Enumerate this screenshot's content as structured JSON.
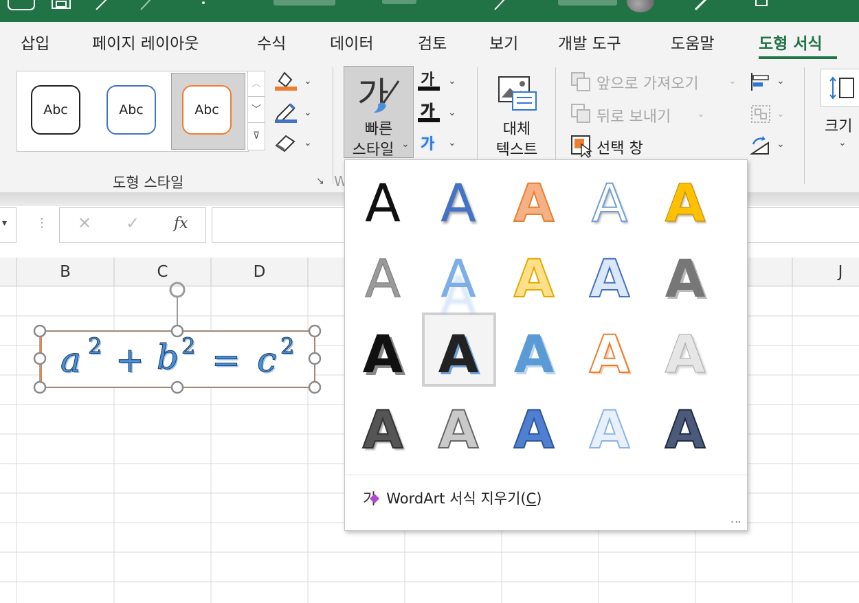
{
  "ribbon_tabs": {
    "insert": "삽입",
    "page_layout": "페이지 레이아웃",
    "formulas": "수식",
    "data": "데이터",
    "review": "검토",
    "view": "보기",
    "developer": "개발 도구",
    "help": "도움말",
    "shape_format": "도형 서식"
  },
  "shape_styles": {
    "gallery_items": [
      "Abc",
      "Abc",
      "Abc"
    ],
    "group_label": "도형 스타일"
  },
  "wordart": {
    "quick_styles_label_line1": "빠른",
    "quick_styles_label_line2": "스타일",
    "text_fill_glyph": "가",
    "text_outline_glyph": "가",
    "text_effects_glyph": "가",
    "quick_styles_glyph": "가"
  },
  "accessibility": {
    "alt_text_line1": "대체",
    "alt_text_line2": "텍스트"
  },
  "arrange": {
    "bring_forward": "앞으로 가져오기",
    "send_backward": "뒤로 보내기",
    "selection_pane": "선택 창"
  },
  "size": {
    "label": "크기"
  },
  "formula_bar": {
    "cancel": "✕",
    "enter": "✓",
    "fx": "fx"
  },
  "columns": [
    "B",
    "C",
    "D",
    "J"
  ],
  "equation": {
    "a": "a",
    "b": "b",
    "c": "c",
    "exp": "2",
    "plus": "+",
    "equals": "="
  },
  "wordart_gallery": {
    "glyph": "A",
    "clear_label": "WordArt 서식 지우기(",
    "clear_key": "C",
    "clear_label_end": ")",
    "clear_icon_glyph": "가"
  },
  "colors": {
    "excel_green": "#217346",
    "accent_orange": "#ed7d31",
    "accent_blue": "#4472c4",
    "gold": "#ffc000"
  }
}
